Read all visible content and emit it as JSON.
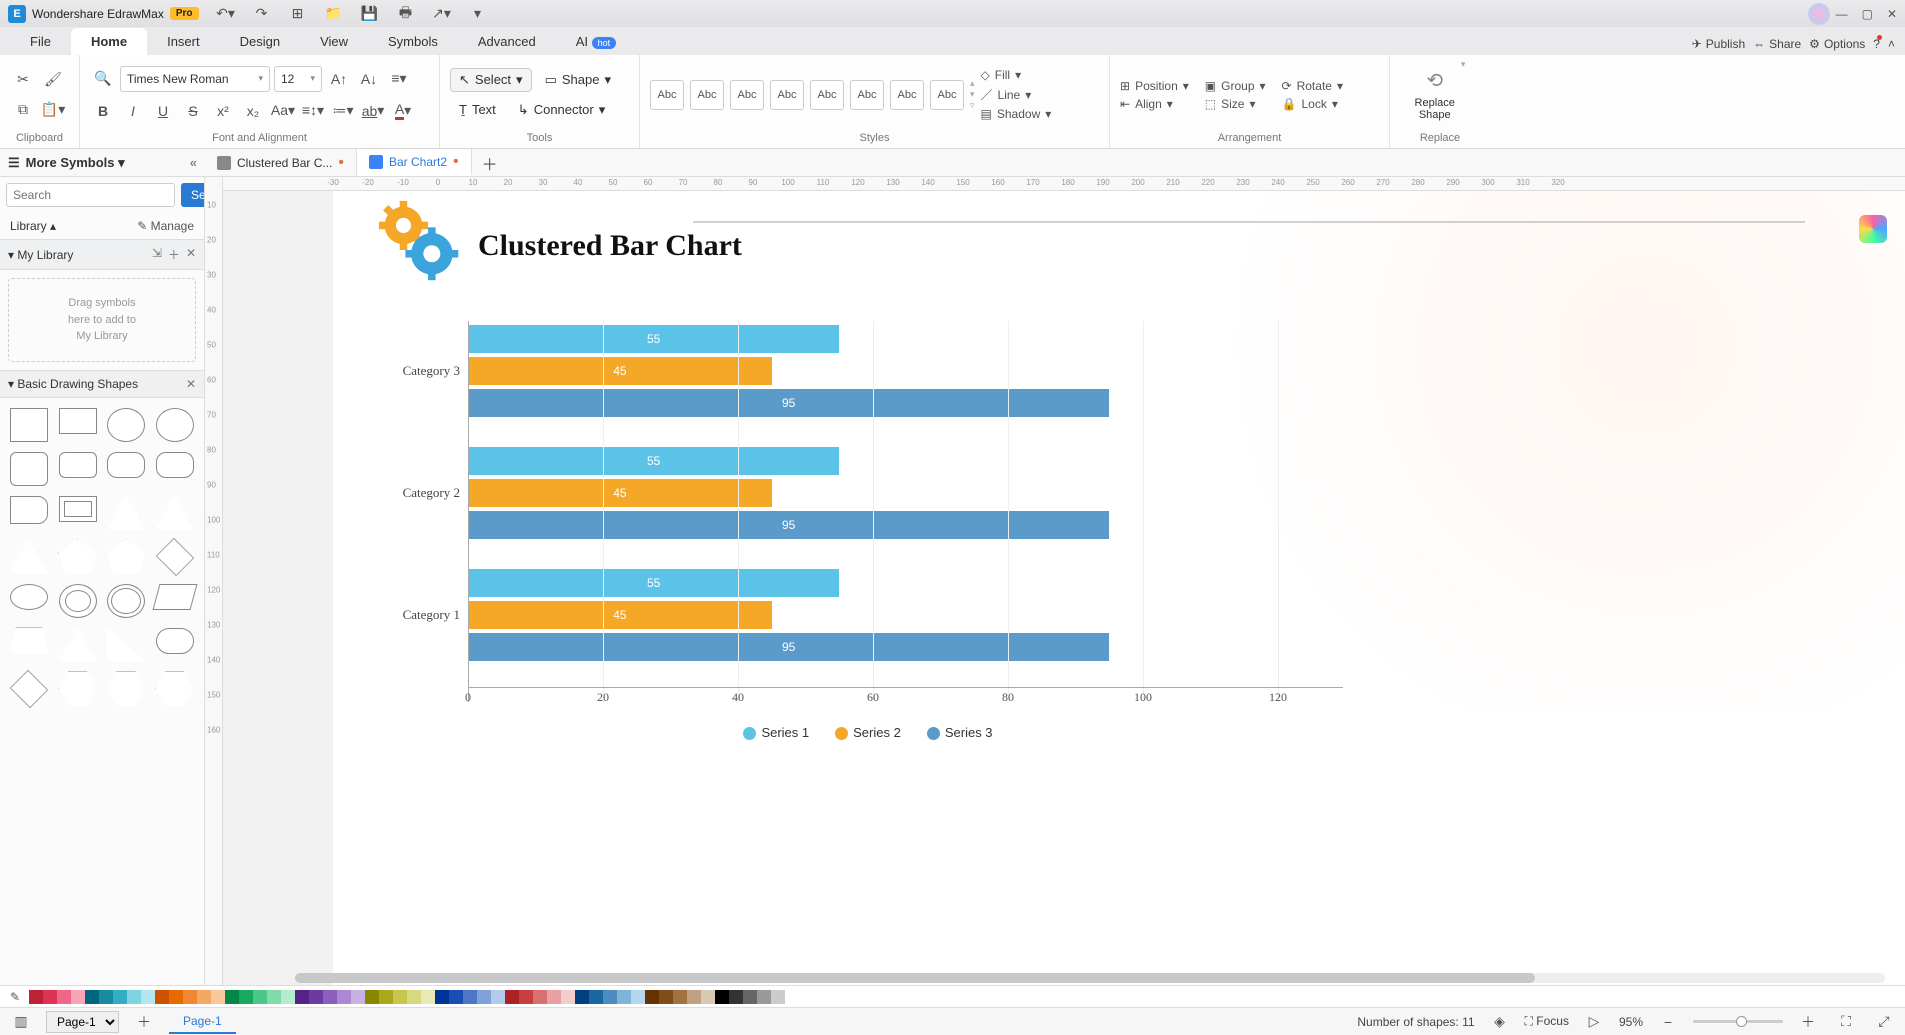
{
  "app": {
    "name": "Wondershare EdrawMax",
    "badge": "Pro"
  },
  "menus": {
    "file": "File",
    "home": "Home",
    "insert": "Insert",
    "design": "Design",
    "view": "View",
    "symbols": "Symbols",
    "advanced": "Advanced",
    "ai": "AI",
    "ai_badge": "hot",
    "publish": "Publish",
    "share": "Share",
    "options": "Options"
  },
  "ribbon": {
    "clipboard": "Clipboard",
    "font_align": "Font and Alignment",
    "tools": "Tools",
    "styles": "Styles",
    "arrangement": "Arrangement",
    "replace": "Replace",
    "font": "Times New Roman",
    "size": "12",
    "select": "Select",
    "shape": "Shape",
    "text": "Text",
    "connector": "Connector",
    "fill": "Fill",
    "line": "Line",
    "shadow": "Shadow",
    "position": "Position",
    "group": "Group",
    "rotate": "Rotate",
    "align": "Align",
    "size_l": "Size",
    "lock": "Lock",
    "replace_shape": "Replace\nShape",
    "abc": "Abc"
  },
  "doctabs": {
    "t1": "Clustered Bar C...",
    "t2": "Bar Chart2"
  },
  "sidebar": {
    "more": "More Symbols",
    "search_ph": "Search",
    "search_btn": "Search",
    "library": "Library",
    "manage": "Manage",
    "mylib": "My Library",
    "drop": "Drag symbols\nhere to add to\nMy Library",
    "basic": "Basic Drawing Shapes"
  },
  "chart_data": {
    "type": "bar",
    "orientation": "horizontal",
    "title": "Clustered Bar Chart",
    "categories": [
      "Category 3",
      "Category 2",
      "Category 1"
    ],
    "series": [
      {
        "name": "Series 1",
        "color": "#5bc3e8",
        "values": [
          55,
          55,
          55
        ]
      },
      {
        "name": "Series 2",
        "color": "#f5a728",
        "values": [
          45,
          45,
          45
        ]
      },
      {
        "name": "Series 3",
        "color": "#5a9bc9",
        "values": [
          95,
          95,
          95
        ]
      }
    ],
    "xlabel": "",
    "ylabel": "",
    "xlim": [
      0,
      120
    ],
    "ticks": [
      0,
      20,
      40,
      60,
      80,
      100,
      120
    ]
  },
  "status": {
    "page_sel": "Page-1",
    "page_tab": "Page-1",
    "shapes": "Number of shapes: 11",
    "focus": "Focus",
    "zoom": "95%"
  },
  "palette": [
    "#bb2233",
    "#dd3355",
    "#ee6688",
    "#f7a4b7",
    "#006680",
    "#1a8aa0",
    "#33adc4",
    "#7dd4e2",
    "#b3e6ee",
    "#cc5200",
    "#e66a00",
    "#f08833",
    "#f5a866",
    "#f9c899",
    "#008844",
    "#1aa860",
    "#4dc788",
    "#80dba8",
    "#b3ecce",
    "#552288",
    "#6d3aa3",
    "#8b5fbe",
    "#aa88d4",
    "#c8b1e5",
    "#888800",
    "#a8a81a",
    "#c6c64d",
    "#d8d880",
    "#e9e9b3",
    "#003399",
    "#1a4db3",
    "#4d77c6",
    "#80a0d8",
    "#b3caeb",
    "#aa2222",
    "#c64040",
    "#d87070",
    "#e8a0a0",
    "#f3cccc",
    "#004080",
    "#1a66a0",
    "#4d8cc0",
    "#80b3d8",
    "#b3d8ee",
    "#663300",
    "#804d1a",
    "#a07340",
    "#c0a080",
    "#d9c8b3",
    "#000000",
    "#333333",
    "#666666",
    "#999999",
    "#cccccc",
    "#ffffff"
  ]
}
